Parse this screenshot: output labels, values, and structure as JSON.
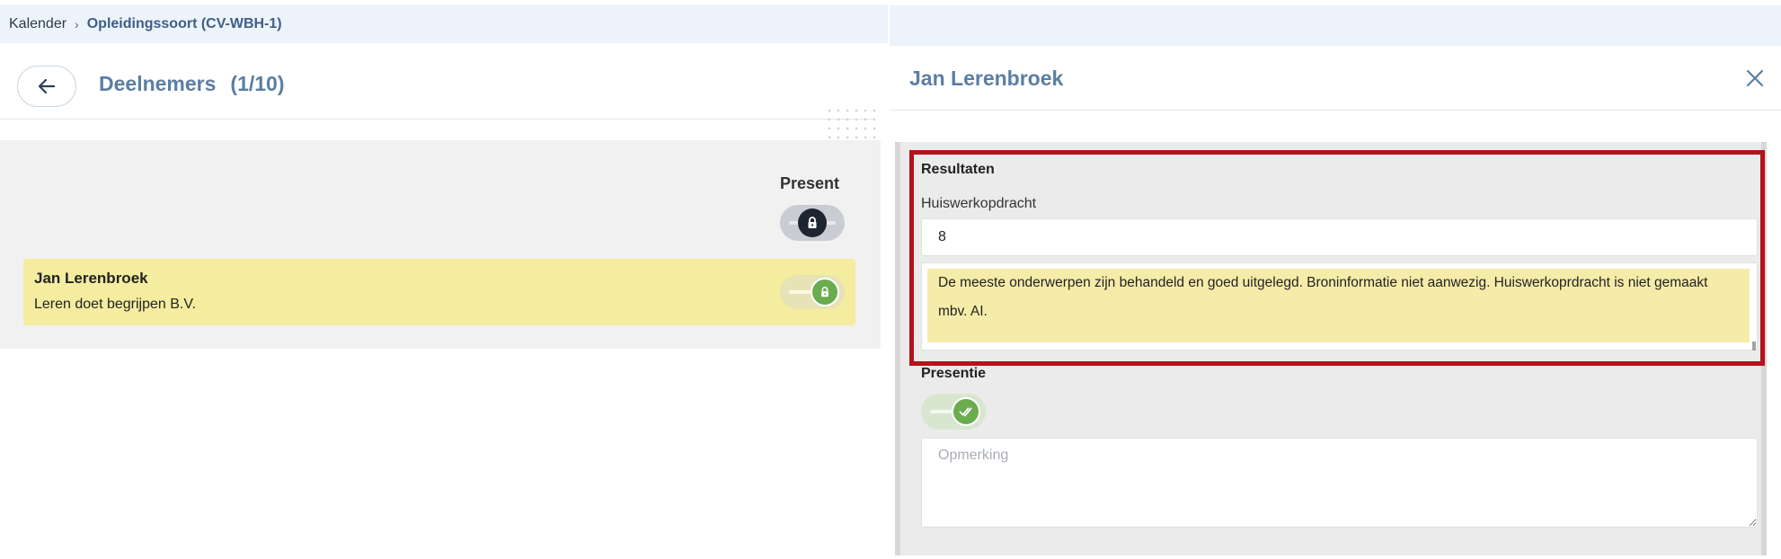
{
  "breadcrumb": {
    "items": [
      "Kalender",
      "Opleidingssoort (CV-WBH-1)"
    ],
    "separator": "›"
  },
  "page": {
    "title": "Deelnemers",
    "count": "(1/10)"
  },
  "list": {
    "present_header": "Present",
    "rows": [
      {
        "name": "Jan Lerenbroek",
        "company": "Leren doet begrijpen B.V."
      }
    ]
  },
  "panel": {
    "title": "Jan Lerenbroek",
    "results_title": "Resultaten",
    "homework_label": "Huiswerkopdracht",
    "homework_value": "8",
    "homework_comment": "De meeste onderwerpen zijn behandeld en goed uitgelegd. Broninformatie niet aanwezig. Huiswerkoprdracht is niet gemaakt mbv. AI.",
    "presence_title": "Presentie",
    "remark_placeholder": "Opmerking"
  },
  "icons": {
    "back": "arrow-left-icon",
    "close": "close-icon",
    "lock": "lock-icon",
    "check": "check-double-icon"
  },
  "colors": {
    "accent": "#5b7ea3",
    "row_highlight": "#f4ec9f",
    "toggle_on": "#6aac4e",
    "highlight_border": "#b5121b"
  }
}
